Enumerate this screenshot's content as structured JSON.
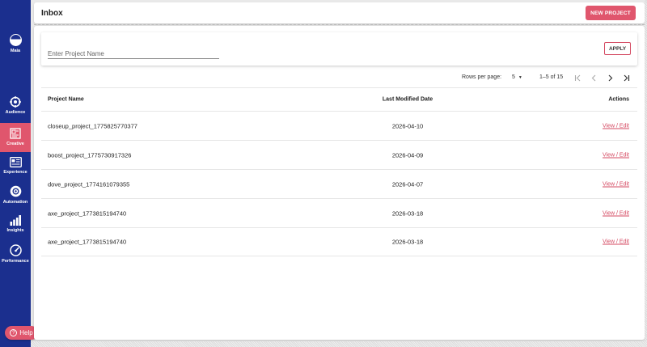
{
  "sidebar": {
    "items": [
      {
        "label": "Maia",
        "icon": "maia-logo-icon"
      },
      {
        "label": "Audience",
        "icon": "audience-target-icon"
      },
      {
        "label": "Creative",
        "icon": "creative-icon",
        "active": true
      },
      {
        "label": "Experience",
        "icon": "experience-icon"
      },
      {
        "label": "Automation",
        "icon": "automation-gear-icon"
      },
      {
        "label": "Insights",
        "icon": "insights-bars-icon"
      },
      {
        "label": "Performance",
        "icon": "performance-gauge-icon"
      }
    ],
    "help_label": "Help"
  },
  "header": {
    "title": "Inbox",
    "new_project_label": "NEW PROJECT"
  },
  "filter": {
    "placeholder": "Enter Project Name",
    "apply_label": "APPLY"
  },
  "pagination": {
    "rows_per_page_label": "Rows per page:",
    "rows_per_page_value": "5",
    "range_text": "1–5 of 15"
  },
  "table": {
    "columns": [
      "Project Name",
      "Last Modified Date",
      "Actions"
    ],
    "rows": [
      {
        "name": "closeup_project_1775825770377",
        "date": "2026-04-10",
        "action": "View / Edit"
      },
      {
        "name": "boost_project_1775730917326",
        "date": "2026-04-09",
        "action": "View / Edit"
      },
      {
        "name": "dove_project_1774161079355",
        "date": "2026-04-07",
        "action": "View / Edit"
      },
      {
        "name": "axe_project_1773815194740",
        "date": "2026-03-18",
        "action": "View / Edit"
      },
      {
        "name": "axe_project_1773815194740",
        "date": "2026-03-18",
        "action": "View / Edit"
      }
    ]
  },
  "colors": {
    "sidebar_bg": "#1b2f8e",
    "accent": "#e0566d"
  }
}
